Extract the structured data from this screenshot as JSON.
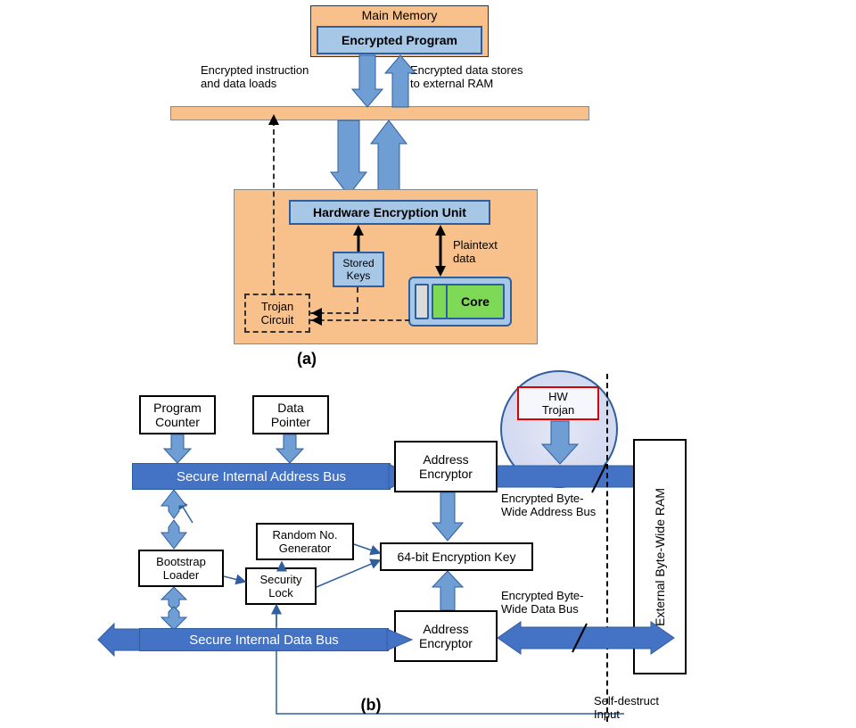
{
  "a": {
    "mainMemory": "Main Memory",
    "encProgram": "Encrypted Program",
    "encInstrLoads": "Encrypted instruction\nand data loads",
    "encDataStores": "Encrypted data stores\nto external RAM",
    "heu": "Hardware Encryption Unit",
    "storedKeys": "Stored\nKeys",
    "plaintext": "Plaintext\ndata",
    "trojan": "Trojan\nCircuit",
    "core": "Core",
    "label": "(a)"
  },
  "b": {
    "programCounter": "Program\nCounter",
    "dataPointer": "Data\nPointer",
    "addrBus": "Secure Internal Address Bus",
    "addrEncTop": "Address\nEncryptor",
    "hwTrojan": "HW\nTrojan",
    "encByteAddr": "Encrypted Byte-\nWide Address Bus",
    "rng": "Random No.\nGenerator",
    "bootstrap": "Bootstrap\nLoader",
    "secLock": "Security\nLock",
    "encKey": "64-bit Encryption Key",
    "addrEncBot": "Address\nEncryptor",
    "encByteData": "Encrypted Byte-\nWide Data Bus",
    "dataBus": "Secure Internal Data Bus",
    "extRam": "External Byte-Wide RAM",
    "selfDestruct": "Self-destruct\nInput",
    "label": "(b)"
  }
}
